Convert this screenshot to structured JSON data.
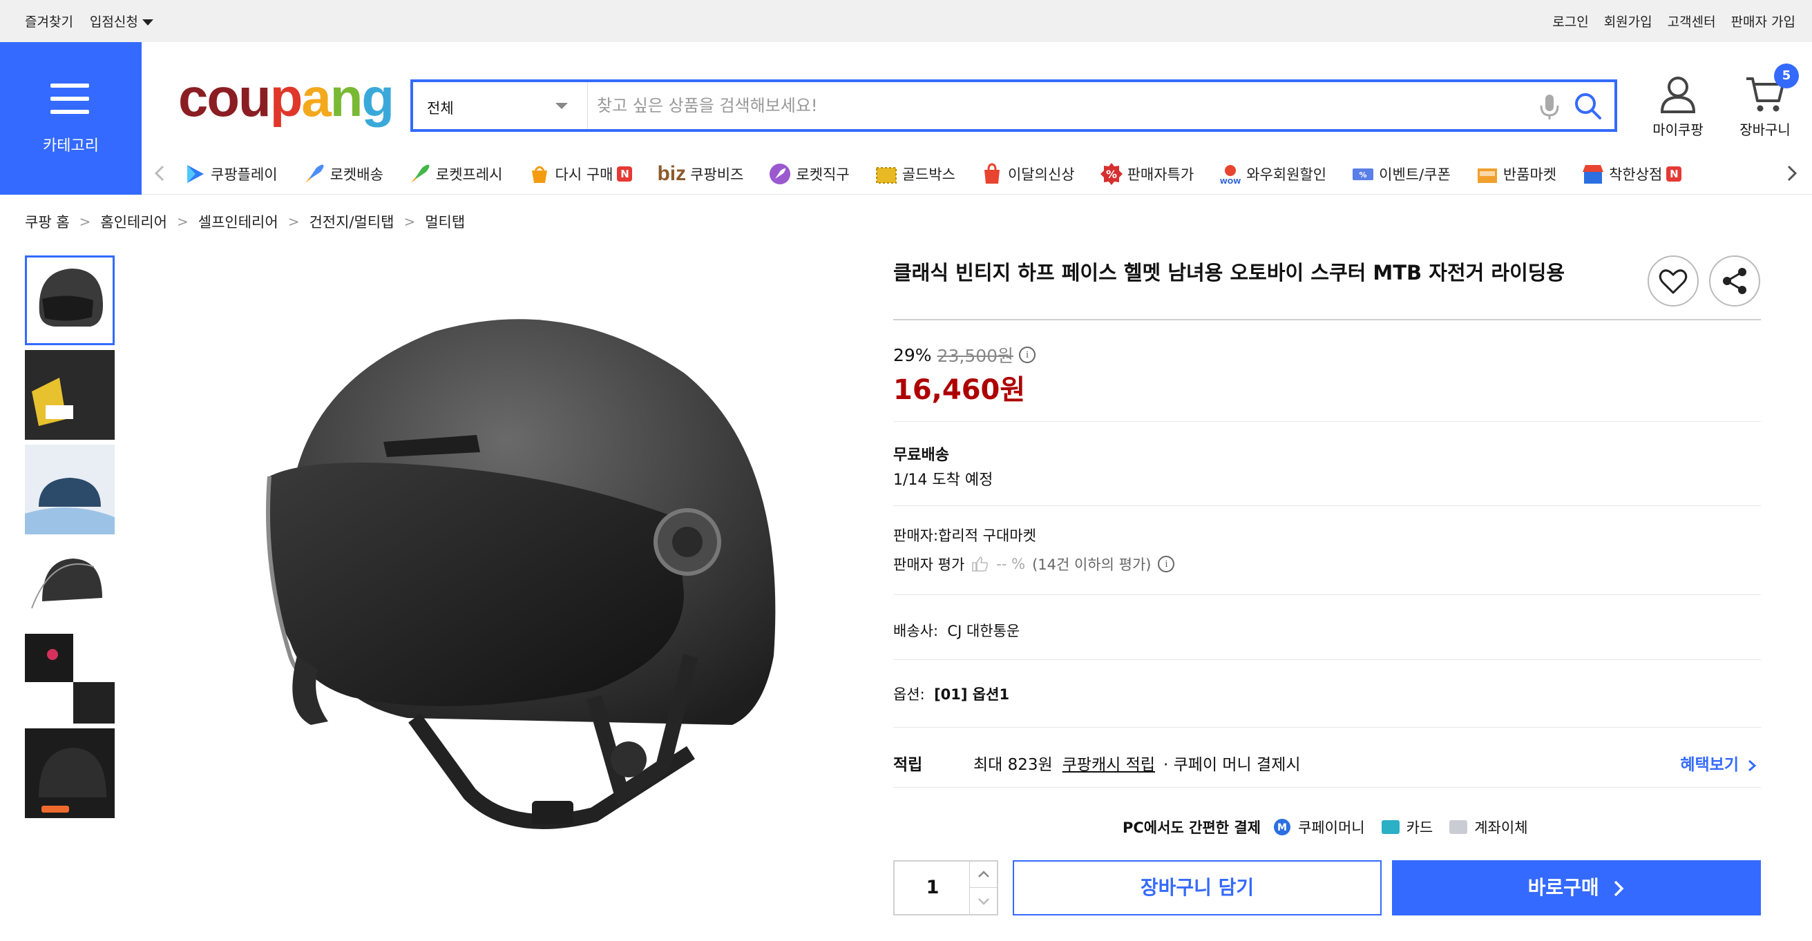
{
  "topbar": {
    "favorites": "즐겨찾기",
    "seller_apply": "입점신청",
    "login": "로그인",
    "signup": "회원가입",
    "customer_center": "고객센터",
    "seller_signup": "판매자 가입"
  },
  "category_button": {
    "label": "카테고리"
  },
  "logo": {
    "text": "coupang"
  },
  "search": {
    "category": "전체",
    "placeholder": "찾고 싶은 상품을 검색해보세요!"
  },
  "header_icons": {
    "my_coupang": "마이쿠팡",
    "cart": "장바구니",
    "cart_count": "5"
  },
  "nav": {
    "items": [
      {
        "label": "쿠팡플레이",
        "icon": "play-icon"
      },
      {
        "label": "로켓배송",
        "icon": "rocket-icon"
      },
      {
        "label": "로켓프레시",
        "icon": "rocket-fresh-icon"
      },
      {
        "label": "다시 구매",
        "icon": "basket-icon",
        "badge": "N"
      },
      {
        "label": "쿠팡비즈",
        "icon": "biz-icon"
      },
      {
        "label": "로켓직구",
        "icon": "rocket-global-icon"
      },
      {
        "label": "골드박스",
        "icon": "goldbox-icon"
      },
      {
        "label": "이달의신상",
        "icon": "shopping-bag-icon"
      },
      {
        "label": "판매자특가",
        "icon": "percent-icon"
      },
      {
        "label": "와우회원할인",
        "icon": "wow-icon"
      },
      {
        "label": "이벤트/쿠폰",
        "icon": "coupon-icon"
      },
      {
        "label": "반품마켓",
        "icon": "return-market-icon"
      },
      {
        "label": "착한상점",
        "icon": "store-icon",
        "badge": "N"
      }
    ]
  },
  "breadcrumb": [
    "쿠팡 홈",
    "홈인테리어",
    "셀프인테리어",
    "건전지/멀티탭",
    "멀티탭"
  ],
  "product": {
    "title": "클래식 빈티지 하프 페이스 헬멧 남녀용 오토바이 스쿠터 MTB 자전거 라이딩용",
    "discount_rate": "29%",
    "original_price": "23,500원",
    "price": "16,460원",
    "shipping_label": "무료배송",
    "arrival": "1/14 도착 예정",
    "seller": "판매자:합리적 구대마켓",
    "seller_rating_label": "판매자 평가",
    "seller_rating_value": "-- %",
    "seller_rating_note": "(14건 이하의 평가)",
    "courier_label": "배송사:",
    "courier": "CJ 대한통운",
    "option_label": "옵션:",
    "option_value": "[01] 옵션1",
    "reward_label": "적립",
    "reward_max": "최대 823원",
    "reward_cash": "쿠팡캐시 적립",
    "reward_note": "· 쿠페이 머니 결제시",
    "benefit_link": "혜택보기",
    "pay_title": "PC에서도 간편한 결제",
    "pay_methods": [
      "쿠페이머니",
      "카드",
      "계좌이체"
    ],
    "quantity": "1",
    "add_to_cart": "장바구니 담기",
    "buy_now": "바로구매"
  },
  "colors": {
    "accent": "#346aff",
    "price_red": "#ae0000",
    "topbar_bg": "#f0f0f0"
  }
}
